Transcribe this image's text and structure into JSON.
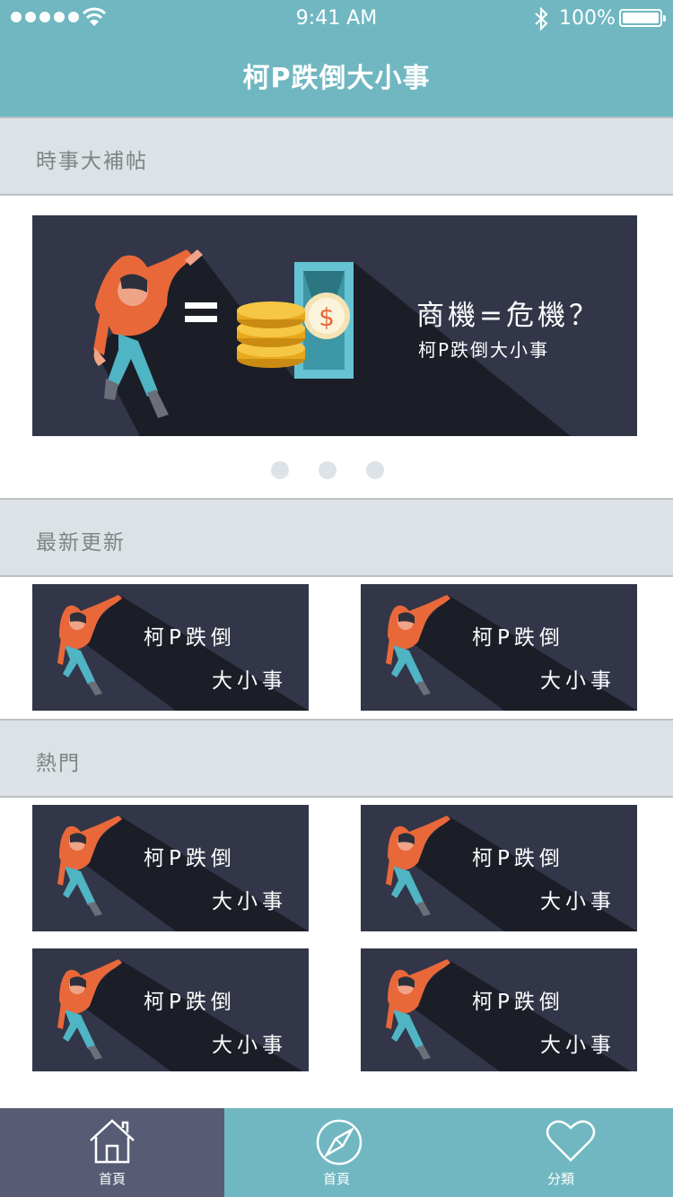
{
  "status_bar": {
    "time": "9:41 AM",
    "battery": "100%"
  },
  "nav": {
    "title": "柯P跌倒大小事"
  },
  "sections": {
    "news": "時事大補帖",
    "latest": "最新更新",
    "popular": "熱門"
  },
  "banner": {
    "title": "商機=危機？",
    "subtitle": "柯P跌倒大小事",
    "page_count": 3
  },
  "latest_cards": [
    {
      "line1": "柯P跌倒",
      "line2": "大小事"
    },
    {
      "line1": "柯P跌倒",
      "line2": "大小事"
    }
  ],
  "popular_cards": [
    {
      "line1": "柯P跌倒",
      "line2": "大小事"
    },
    {
      "line1": "柯P跌倒",
      "line2": "大小事"
    },
    {
      "line1": "柯P跌倒",
      "line2": "大小事"
    },
    {
      "line1": "柯P跌倒",
      "line2": "大小事"
    }
  ],
  "tabs": [
    {
      "label": "首頁",
      "icon": "home-icon",
      "active": true
    },
    {
      "label": "首頁",
      "icon": "compass-icon",
      "active": false
    },
    {
      "label": "分類",
      "icon": "heart-icon",
      "active": false
    }
  ],
  "colors": {
    "header": "#70b7c1",
    "card": "#323648",
    "active_tab": "#575c74",
    "section": "#dce2e5"
  }
}
